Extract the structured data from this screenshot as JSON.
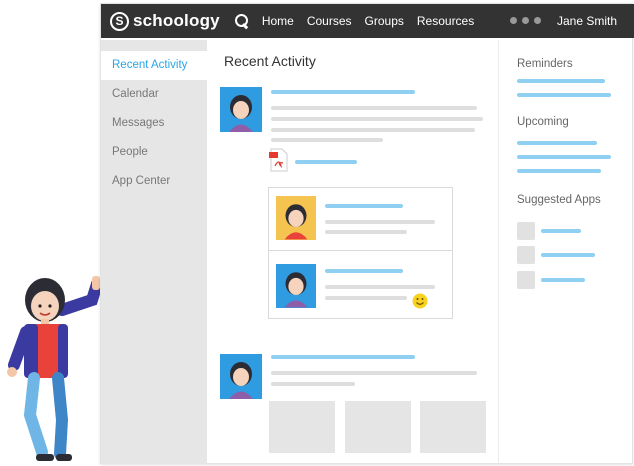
{
  "app": {
    "logo_letter": "S",
    "logo_text": "schoology"
  },
  "nav": {
    "items": [
      "Home",
      "Courses",
      "Groups",
      "Resources"
    ]
  },
  "user": {
    "name": "Jane Smith"
  },
  "sidebar": {
    "items": [
      {
        "label": "Recent Activity",
        "active": true
      },
      {
        "label": "Calendar"
      },
      {
        "label": "Messages"
      },
      {
        "label": "People"
      },
      {
        "label": "App Center"
      }
    ]
  },
  "main": {
    "title": "Recent Activity"
  },
  "right": {
    "reminders": "Reminders",
    "upcoming": "Upcoming",
    "suggested_apps": "Suggested Apps"
  },
  "colors": {
    "accent": "#2aa5e5",
    "topbar": "#333333",
    "sidebar": "#e6e6e6",
    "placeholder_line": "#8fd0f2"
  },
  "icons": [
    "search-icon",
    "more-dots-icon",
    "pdf-file-icon",
    "smiley-emoji-icon"
  ]
}
